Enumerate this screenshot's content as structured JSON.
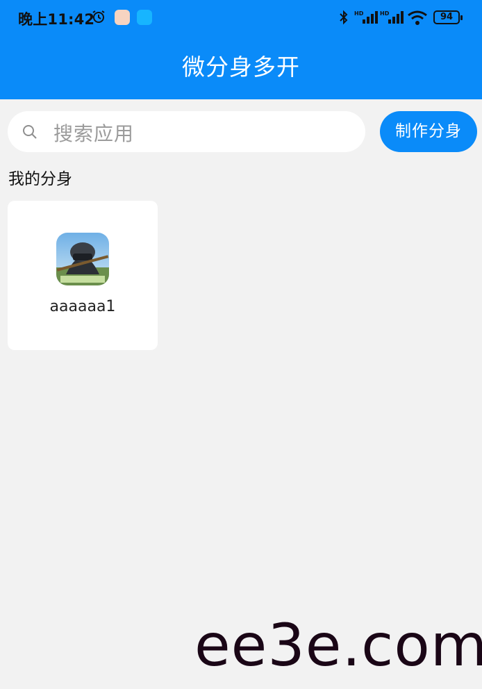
{
  "status_bar": {
    "time": "晚上11:42",
    "battery": "94",
    "icons": [
      "alarm-icon",
      "app-icon",
      "chat-icon",
      "bluetooth-icon",
      "signal-hd-icon",
      "signal-hd-icon",
      "wifi-icon",
      "battery-icon"
    ]
  },
  "header": {
    "title": "微分身多开",
    "color": "#0a8bf9"
  },
  "search": {
    "placeholder": "搜索应用",
    "icon": "search-icon"
  },
  "actions": {
    "make_clone_label": "制作分身"
  },
  "section": {
    "my_clones_title": "我的分身"
  },
  "clones": [
    {
      "name": "aaaaaa1",
      "icon": "game-app-icon"
    }
  ],
  "watermark": "ee3e.com"
}
